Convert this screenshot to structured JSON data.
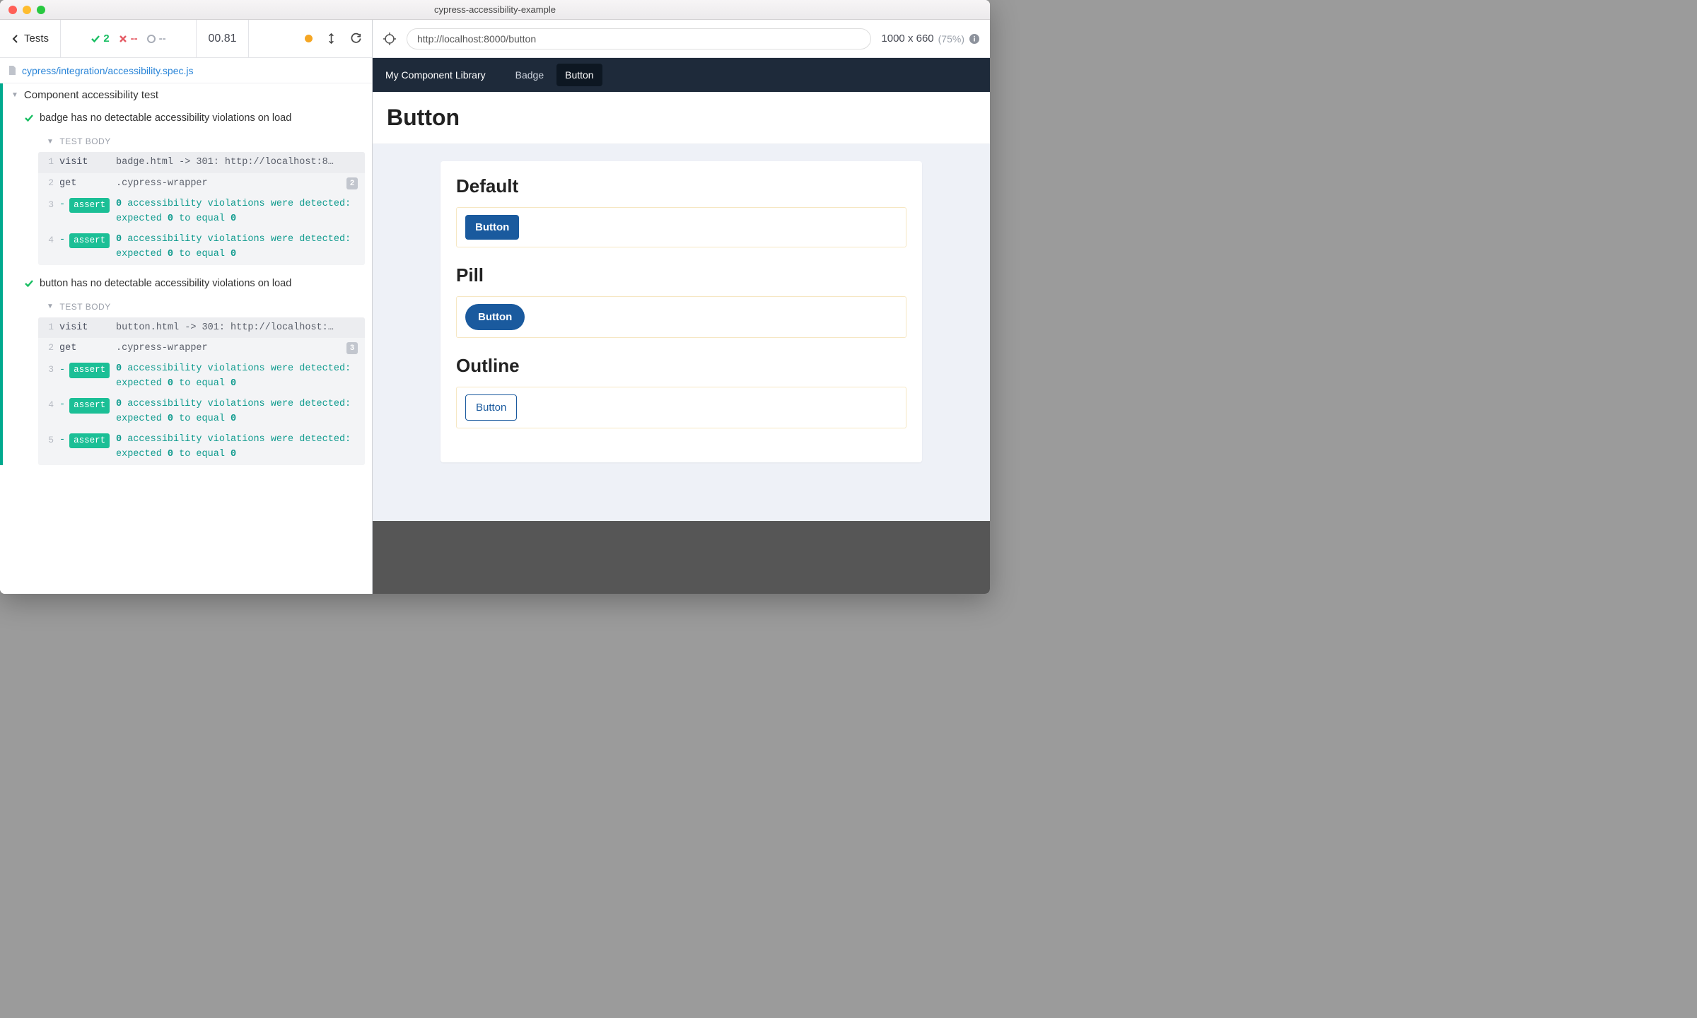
{
  "window_title": "cypress-accessibility-example",
  "toolbar": {
    "back_label": "Tests",
    "pass_count": "2",
    "fail_count": "--",
    "pending_count": "--",
    "duration": "00.81"
  },
  "spec_file": "cypress/integration/accessibility.spec.js",
  "suite": {
    "title": "Component accessibility test",
    "tests": [
      {
        "name": "badge has no detectable accessibility violations on load",
        "body_label": "TEST BODY",
        "commands": [
          {
            "n": "1",
            "cmd": "visit",
            "msg_html": "badge.html -> 301: http://localhost:8…",
            "first": true
          },
          {
            "n": "2",
            "cmd": "get",
            "msg_html": ".cypress-wrapper",
            "badge": "2"
          },
          {
            "n": "3",
            "cmd": "assert",
            "teal": true,
            "msg_html": "<b>0</b> accessibility violations were detected: expected <b>0</b> to equal <b>0</b>"
          },
          {
            "n": "4",
            "cmd": "assert",
            "teal": true,
            "msg_html": "<b>0</b> accessibility violations were detected: expected <b>0</b> to equal <b>0</b>"
          }
        ]
      },
      {
        "name": "button has no detectable accessibility violations on load",
        "body_label": "TEST BODY",
        "commands": [
          {
            "n": "1",
            "cmd": "visit",
            "msg_html": "button.html -> 301: http://localhost:…",
            "first": true
          },
          {
            "n": "2",
            "cmd": "get",
            "msg_html": ".cypress-wrapper",
            "badge": "3"
          },
          {
            "n": "3",
            "cmd": "assert",
            "teal": true,
            "msg_html": "<b>0</b> accessibility violations were detected: expected <b>0</b> to equal <b>0</b>"
          },
          {
            "n": "4",
            "cmd": "assert",
            "teal": true,
            "msg_html": "<b>0</b> accessibility violations were detected: expected <b>0</b> to equal <b>0</b>"
          },
          {
            "n": "5",
            "cmd": "assert",
            "teal": true,
            "msg_html": "<b>0</b> accessibility violations were detected: expected <b>0</b> to equal <b>0</b>"
          }
        ]
      }
    ]
  },
  "preview": {
    "url": "http://localhost:8000/button",
    "viewport": "1000 x 660",
    "scale": "(75%)",
    "nav_brand": "My Component Library",
    "nav_items": [
      {
        "label": "Badge",
        "active": false
      },
      {
        "label": "Button",
        "active": true
      }
    ],
    "page_title": "Button",
    "sections": [
      {
        "heading": "Default",
        "button_label": "Button",
        "variant": "default"
      },
      {
        "heading": "Pill",
        "button_label": "Button",
        "variant": "pill"
      },
      {
        "heading": "Outline",
        "button_label": "Button",
        "variant": "outline"
      }
    ]
  }
}
